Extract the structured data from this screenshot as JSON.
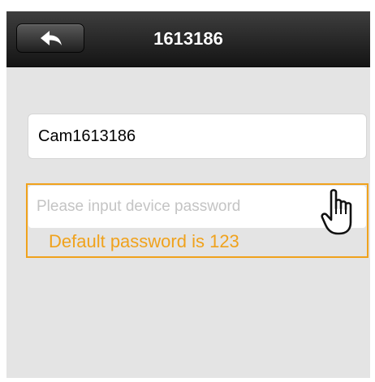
{
  "header": {
    "title": "1613186",
    "back_icon": "back-arrow-icon"
  },
  "form": {
    "device_name": {
      "value": "Cam1613186"
    },
    "password": {
      "placeholder": "Please input device password",
      "value": ""
    },
    "hint": "Default password is 123"
  },
  "annotation": {
    "icon": "pointing-hand-icon",
    "highlight_color": "#f0a21c"
  },
  "colors": {
    "navbar": "#1e1e1e",
    "background": "#e4e4e4",
    "accent": "#f0a21c"
  }
}
